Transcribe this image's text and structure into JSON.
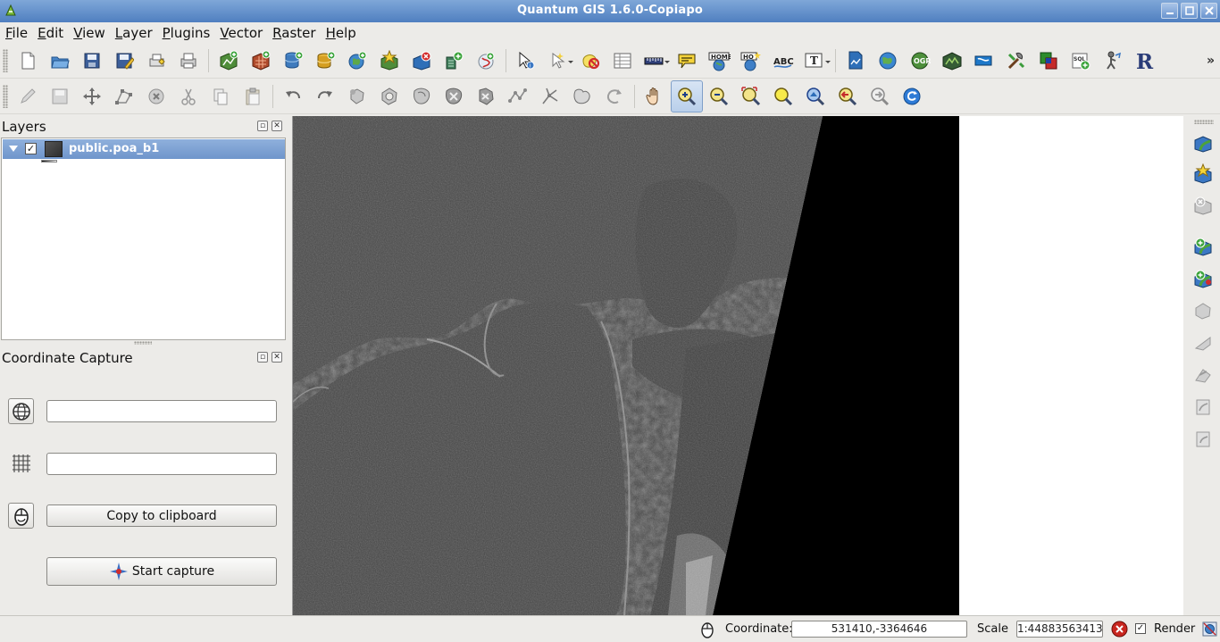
{
  "window": {
    "title": "Quantum GIS 1.6.0-Copiapo"
  },
  "menu": [
    {
      "label": "File",
      "mnemonic": "F",
      "rest": "ile"
    },
    {
      "label": "Edit",
      "mnemonic": "E",
      "rest": "dit"
    },
    {
      "label": "View",
      "mnemonic": "V",
      "rest": "iew"
    },
    {
      "label": "Layer",
      "mnemonic": "L",
      "rest": "ayer"
    },
    {
      "label": "Plugins",
      "mnemonic": "P",
      "rest": "lugins"
    },
    {
      "label": "Vector",
      "mnemonic": "V",
      "rest": "ector"
    },
    {
      "label": "Raster",
      "mnemonic": "R",
      "rest": "aster"
    },
    {
      "label": "Help",
      "mnemonic": "H",
      "rest": "elp"
    }
  ],
  "toolbar_more": "»",
  "layers_panel": {
    "title": "Layers",
    "layers": [
      {
        "name": "public.poa_b1",
        "checked": "✓"
      }
    ]
  },
  "coordinate_capture": {
    "title": "Coordinate Capture",
    "field_1_value": "",
    "field_2_value": "",
    "copy_label": "Copy to clipboard",
    "start_label": "Start capture"
  },
  "statusbar": {
    "coordinate_label": "Coordinate:",
    "coordinate_value": "531410,-3364646",
    "scale_label": "Scale",
    "scale_value": "1:44883563413",
    "render_label": "Render",
    "render_checked": "✓"
  },
  "colors": {
    "selection": "#7ea2d3",
    "title_bar": "#5f8cc8",
    "map_background": "#ffffff"
  }
}
